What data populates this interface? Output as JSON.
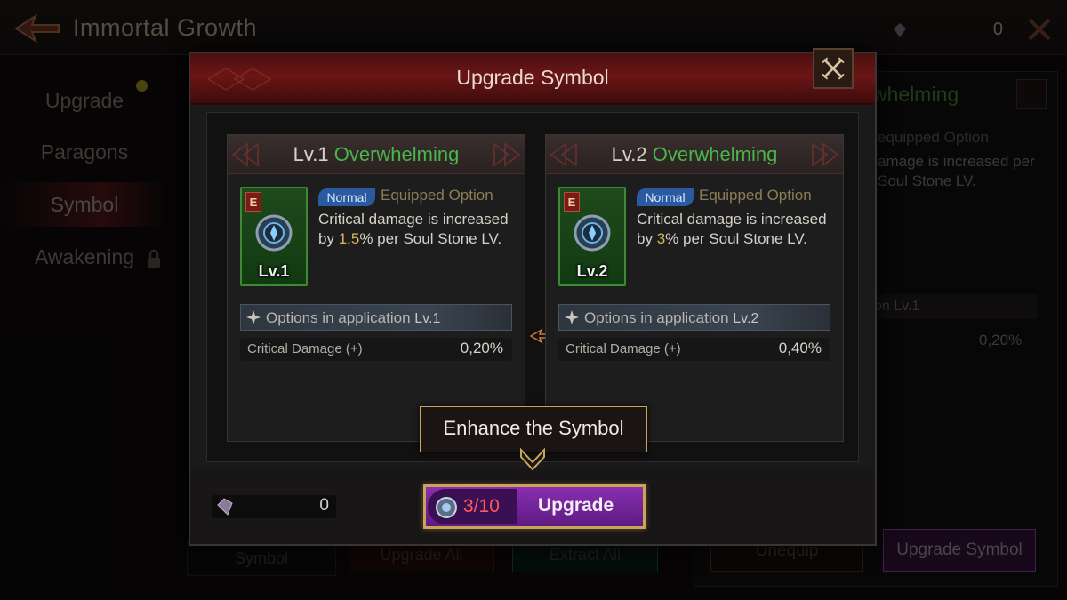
{
  "background": {
    "title": "Immortal Growth",
    "currency_value": "0",
    "nav": [
      {
        "label": "Upgrade"
      },
      {
        "label": "Paragons"
      },
      {
        "label": "Symbol"
      },
      {
        "label": "Awakening"
      }
    ],
    "panel": {
      "title": "whelming",
      "equipped": "equipped Option",
      "desc": "amage is increased per Soul Stone LV.",
      "option": "on Lv.1",
      "value": "0,20%",
      "unequip": "Unequip",
      "upgrade_symbol": "Upgrade Symbol"
    },
    "bottom": {
      "symbol": "Symbol",
      "upgrade_all": "Upgrade All",
      "extract_all": "Extract All"
    }
  },
  "modal": {
    "title": "Upgrade Symbol",
    "cards": [
      {
        "level": "Lv.1",
        "name": "Overwhelming",
        "grade": "E",
        "icon_level": "Lv.1",
        "badge": "Normal",
        "equipped_label": "Equipped Option",
        "desc_pre": "Critical damage is increased by ",
        "desc_value": "1,5",
        "desc_post": "% per Soul Stone LV.",
        "options_label": "Options in application",
        "options_level": "Lv.1",
        "stat_name": "Critical Damage (+)",
        "stat_value": "0,20%"
      },
      {
        "level": "Lv.2",
        "name": "Overwhelming",
        "grade": "E",
        "icon_level": "Lv.2",
        "badge": "Normal",
        "equipped_label": "Equipped Option",
        "desc_pre": "Critical damage is increased by ",
        "desc_value": "3",
        "desc_post": "% per Soul Stone LV.",
        "options_label": "Options in application",
        "options_level": "Lv.2",
        "stat_name": "Critical Damage (+)",
        "stat_value": "0,40%"
      }
    ],
    "gem_value": "0",
    "upgrade": {
      "count": "3/10",
      "label": "Upgrade"
    },
    "tooltip": "Enhance the Symbol"
  },
  "colors": {
    "accent_gold": "#c7a45a",
    "name_green": "#49b54a",
    "count_red": "#ff5a5a",
    "button_purple": "#7a28a0"
  },
  "icons": [
    "back-arrow-icon",
    "gem-icon",
    "close-icon",
    "lock-icon",
    "symbol-emblem-icon",
    "compass-icon",
    "right-arrow-icon",
    "chevron-down-icon",
    "coin-icon"
  ]
}
